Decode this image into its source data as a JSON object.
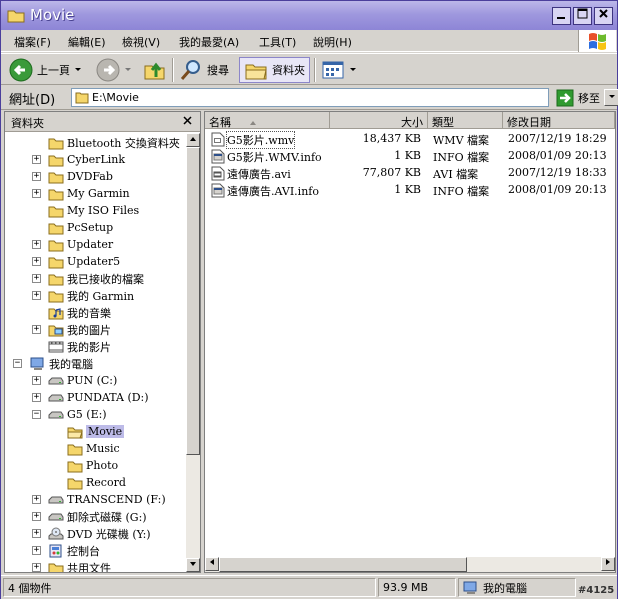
{
  "window": {
    "title": "Movie"
  },
  "menu": {
    "items": [
      "檔案(F)",
      "編輯(E)",
      "檢視(V)",
      "我的最愛(A)",
      "工具(T)",
      "說明(H)"
    ]
  },
  "toolbar": {
    "back_label": "上一頁",
    "search_label": "搜尋",
    "folders_label": "資料夾"
  },
  "address": {
    "label": "網址(D)",
    "value": "E:\\Movie",
    "go_label": "移至"
  },
  "folders": {
    "title": "資料夾",
    "items": [
      {
        "label": "Bluetooth 交換資料夾",
        "level": 2,
        "expander": "",
        "icon": "folder"
      },
      {
        "label": "CyberLink",
        "level": 2,
        "expander": "+",
        "icon": "folder"
      },
      {
        "label": "DVDFab",
        "level": 2,
        "expander": "+",
        "icon": "folder"
      },
      {
        "label": "My Garmin",
        "level": 2,
        "expander": "+",
        "icon": "folder"
      },
      {
        "label": "My ISO Files",
        "level": 2,
        "expander": "",
        "icon": "folder"
      },
      {
        "label": "PcSetup",
        "level": 2,
        "expander": "",
        "icon": "folder"
      },
      {
        "label": "Updater",
        "level": 2,
        "expander": "+",
        "icon": "folder"
      },
      {
        "label": "Updater5",
        "level": 2,
        "expander": "+",
        "icon": "folder"
      },
      {
        "label": "我已接收的檔案",
        "level": 2,
        "expander": "+",
        "icon": "folder"
      },
      {
        "label": "我的 Garmin",
        "level": 2,
        "expander": "+",
        "icon": "folder"
      },
      {
        "label": "我的音樂",
        "level": 2,
        "expander": "",
        "icon": "music"
      },
      {
        "label": "我的圖片",
        "level": 2,
        "expander": "+",
        "icon": "pictures"
      },
      {
        "label": "我的影片",
        "level": 2,
        "expander": "",
        "icon": "video"
      },
      {
        "label": "我的電腦",
        "level": 1,
        "expander": "−",
        "icon": "computer"
      },
      {
        "label": "PUN (C:)",
        "level": 2,
        "expander": "+",
        "icon": "drive"
      },
      {
        "label": "PUNDATA (D:)",
        "level": 2,
        "expander": "+",
        "icon": "drive"
      },
      {
        "label": "G5 (E:)",
        "level": 2,
        "expander": "−",
        "icon": "drive"
      },
      {
        "label": "Movie",
        "level": 3,
        "expander": "",
        "icon": "folder-open",
        "selected": true
      },
      {
        "label": "Music",
        "level": 3,
        "expander": "",
        "icon": "folder"
      },
      {
        "label": "Photo",
        "level": 3,
        "expander": "",
        "icon": "folder"
      },
      {
        "label": "Record",
        "level": 3,
        "expander": "",
        "icon": "folder"
      },
      {
        "label": "TRANSCEND (F:)",
        "level": 2,
        "expander": "+",
        "icon": "drive"
      },
      {
        "label": "卸除式磁碟 (G:)",
        "level": 2,
        "expander": "+",
        "icon": "drive"
      },
      {
        "label": "DVD 光碟機 (Y:)",
        "level": 2,
        "expander": "+",
        "icon": "cdrom"
      },
      {
        "label": "控制台",
        "level": 2,
        "expander": "+",
        "icon": "control-panel"
      },
      {
        "label": "共用文件",
        "level": 2,
        "expander": "+",
        "icon": "folder"
      }
    ]
  },
  "files": {
    "columns": [
      "名稱",
      "大小",
      "類型",
      "修改日期"
    ],
    "rows": [
      {
        "name": "G5影片.wmv",
        "size": "18,437 KB",
        "type": "WMV 檔案",
        "date": "2007/12/19 18:29"
      },
      {
        "name": "G5影片.WMV.info",
        "size": "1 KB",
        "type": "INFO 檔案",
        "date": "2008/01/09 20:13"
      },
      {
        "name": "遠傳廣告.avi",
        "size": "77,807 KB",
        "type": "AVI 檔案",
        "date": "2007/12/19 18:33"
      },
      {
        "name": "遠傳廣告.AVI.info",
        "size": "1 KB",
        "type": "INFO 檔案",
        "date": "2008/01/09 20:13"
      }
    ]
  },
  "status": {
    "count": "4 個物件",
    "size": "93.9 MB",
    "location": "我的電腦"
  },
  "watermark": "#4125"
}
